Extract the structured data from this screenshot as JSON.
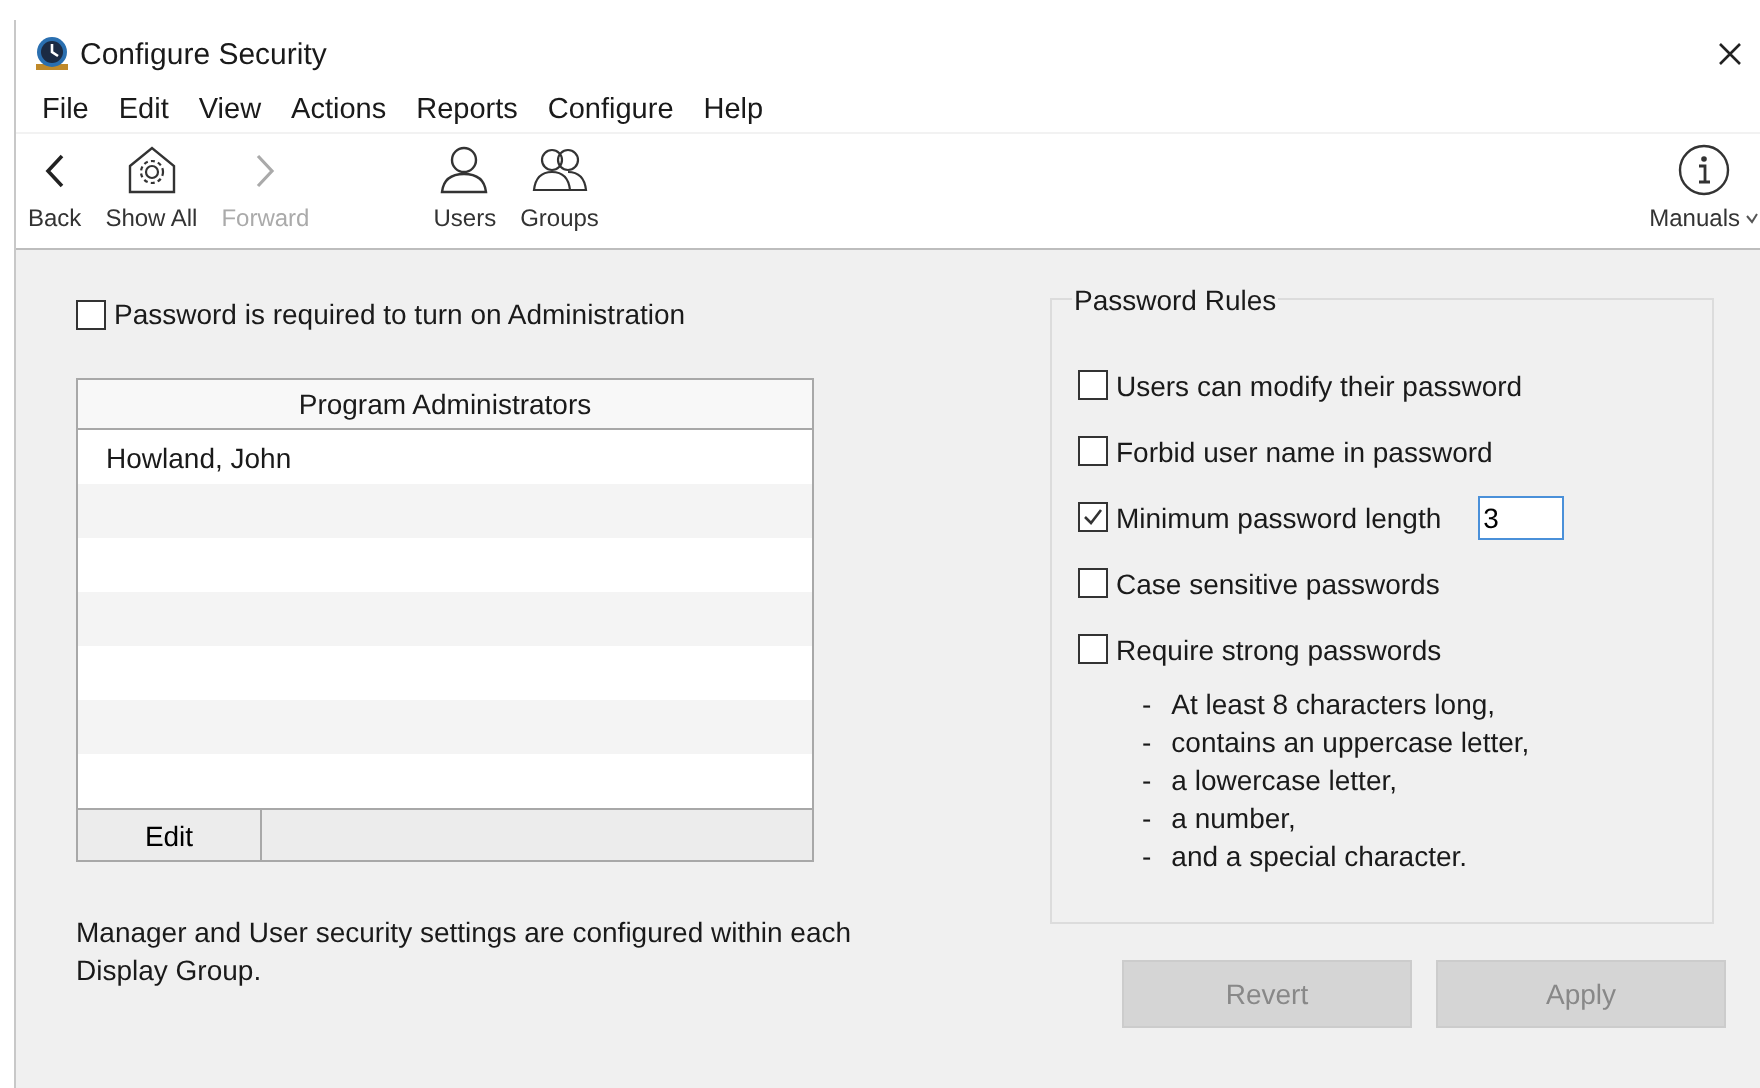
{
  "window": {
    "title": "Configure Security"
  },
  "menu": [
    "File",
    "Edit",
    "View",
    "Actions",
    "Reports",
    "Configure",
    "Help"
  ],
  "toolbar": [
    {
      "kind": "back",
      "label": "Back",
      "disabled": false
    },
    {
      "kind": "home",
      "label": "Show All",
      "disabled": false
    },
    {
      "kind": "forward",
      "label": "Forward",
      "disabled": true
    },
    {
      "kind": "user",
      "label": "Users",
      "disabled": false
    },
    {
      "kind": "group",
      "label": "Groups",
      "disabled": false
    }
  ],
  "manuals": {
    "label": "Manuals"
  },
  "admin_password": {
    "label": "Password is required to turn on Administration",
    "checked": false
  },
  "table": {
    "columns": [
      "Program Administrators"
    ],
    "rows": [
      [
        "Howland, John"
      ]
    ],
    "footer_button": "Edit"
  },
  "note": "Manager and User security settings are configured within each Display Group.",
  "password_rules": {
    "title": "Password Rules",
    "options": [
      {
        "label": "Users can modify their password",
        "checked": false
      },
      {
        "label": "Forbid user name in password",
        "checked": false
      },
      {
        "label": "Minimum password length",
        "checked": true,
        "value": "3"
      },
      {
        "label": "Case sensitive passwords",
        "checked": false
      },
      {
        "label": "Require strong passwords",
        "checked": false
      }
    ],
    "requirements": [
      {
        "dash": "-",
        "text": "At least 8 characters long,"
      },
      {
        "dash": "-",
        "text": "contains an uppercase letter,"
      },
      {
        "dash": "-",
        "text": "a lowercase letter,"
      },
      {
        "dash": "-",
        "text": "a number,"
      },
      {
        "dash": "-",
        "text": "and a special character."
      }
    ]
  },
  "buttons": [
    {
      "label": "Revert",
      "disabled": true
    },
    {
      "label": "Apply",
      "disabled": true
    }
  ]
}
